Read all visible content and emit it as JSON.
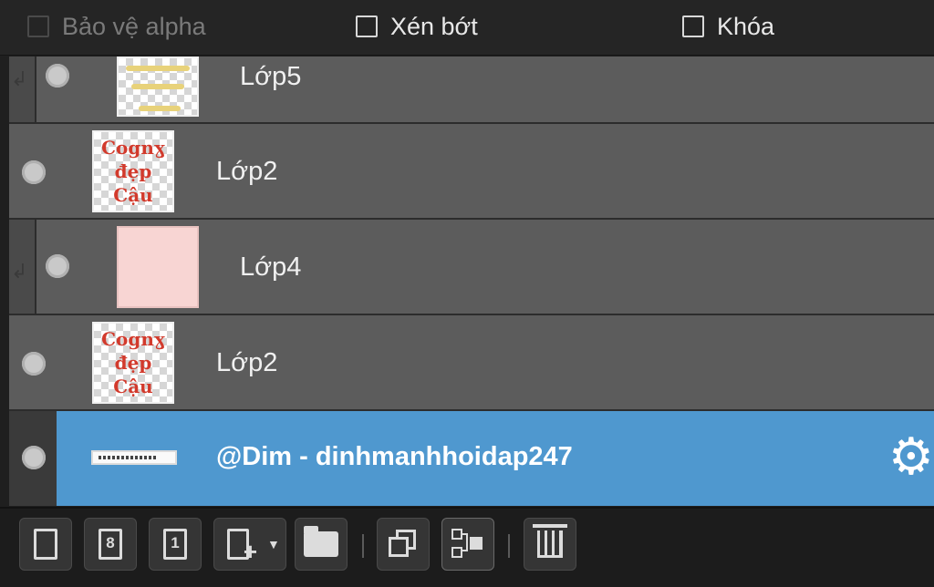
{
  "options": {
    "alpha_protect": {
      "label": "Bảo vệ alpha",
      "checked": false,
      "enabled": false
    },
    "clip": {
      "label": "Xén bớt",
      "checked": false,
      "enabled": true
    },
    "lock": {
      "label": "Khóa",
      "checked": false,
      "enabled": true
    }
  },
  "layers": [
    {
      "name": "Lớp5",
      "visible": true,
      "clipped": true,
      "thumb": "yellow-stripes"
    },
    {
      "name": "Lớp2",
      "visible": true,
      "clipped": false,
      "thumb": "red-text"
    },
    {
      "name": "Lớp4",
      "visible": true,
      "clipped": true,
      "thumb": "pink-fill"
    },
    {
      "name": "Lớp2",
      "visible": true,
      "clipped": false,
      "thumb": "red-text"
    },
    {
      "name": "@Dim - dinhmanhhoidap247",
      "visible": true,
      "clipped": false,
      "selected": true,
      "thumb": "text-bar"
    }
  ],
  "thumb_text": [
    "Cognɣ",
    "đẹp",
    "Cậu"
  ],
  "toolbar": {
    "buttons": [
      {
        "name": "new-layer-button",
        "icon": "new-page-icon"
      },
      {
        "name": "new-8bit-layer-button",
        "icon": "page-8-icon",
        "glyph": "8"
      },
      {
        "name": "new-1bit-layer-button",
        "icon": "page-1-icon",
        "glyph": "1"
      },
      {
        "name": "add-layer-menu-button",
        "icon": "page-plus-dropdown-icon"
      },
      {
        "name": "new-folder-button",
        "icon": "folder-icon"
      },
      {
        "name": "duplicate-layer-button",
        "icon": "duplicate-icon"
      },
      {
        "name": "merge-layer-button",
        "icon": "merge-down-icon"
      },
      {
        "name": "delete-layer-button",
        "icon": "trash-icon"
      }
    ]
  },
  "colors": {
    "selected_bg": "#4f98cf",
    "layer_bg": "#5c5c5c",
    "panel_bg": "#1f1f1f"
  }
}
